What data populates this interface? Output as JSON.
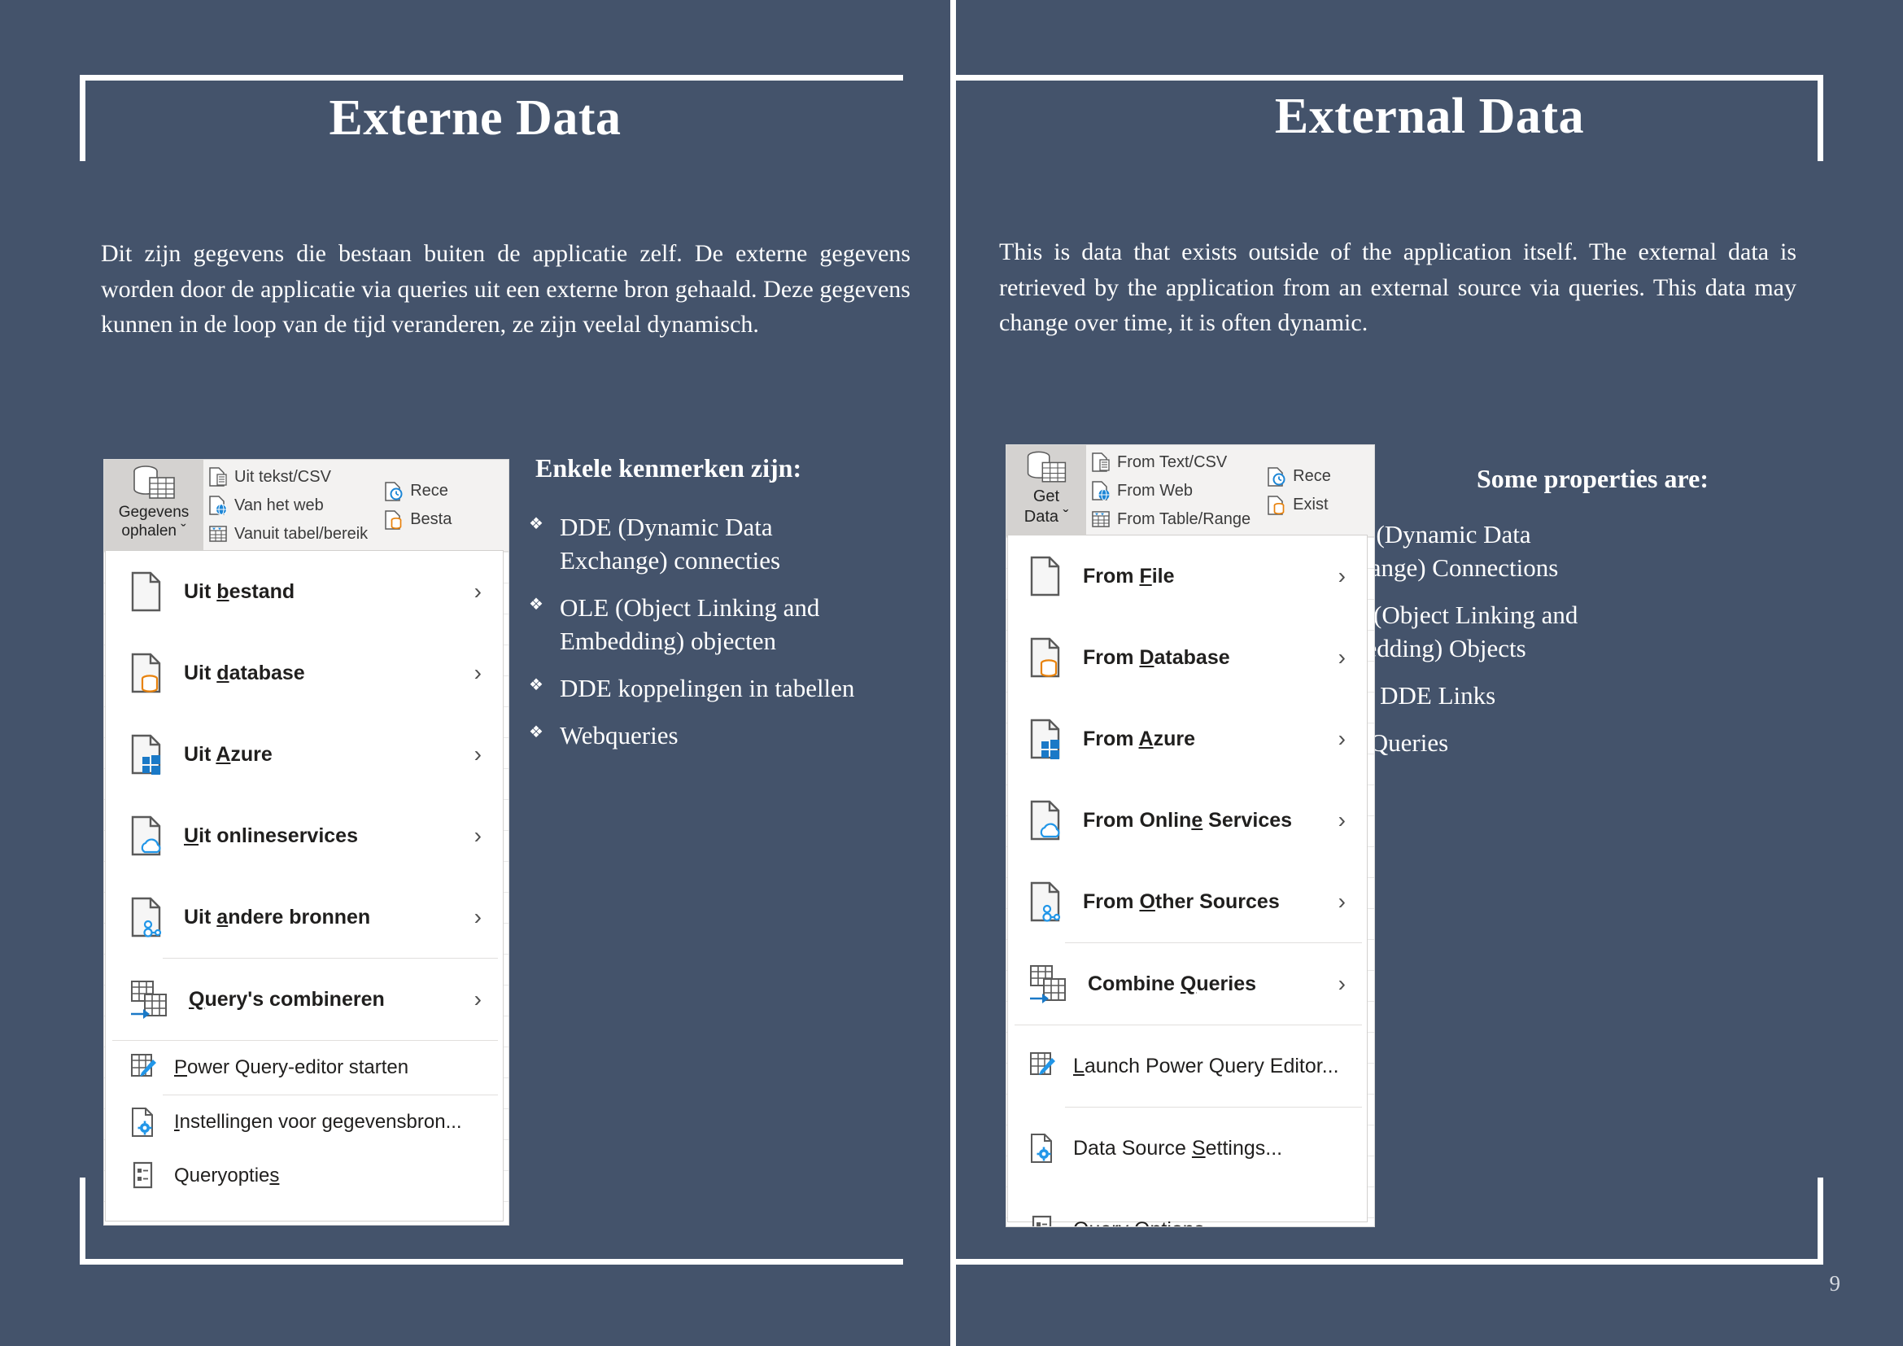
{
  "page": {
    "number": "9",
    "background_color": "#44536b",
    "accent_color": "#ffffff"
  },
  "left": {
    "title": "Externe Data",
    "paragraph": "Dit zijn gegevens die bestaan buiten de applicatie zelf. De externe gegevens worden door de applicatie via queries uit een externe bron gehaald. Deze gegevens kunnen in de loop van de tijd veranderen, ze zijn veelal dynamisch.",
    "properties_heading": "Enkele kenmerken zijn:",
    "properties": [
      "DDE (Dynamic Data Exchange) connecties",
      "OLE (Object Linking and Embedding) objecten",
      "DDE koppelingen in tabellen",
      "Webqueries"
    ],
    "bullet_glyph": "❖",
    "excel": {
      "ribbon_button": {
        "line1": "Gegevens",
        "line2": "ophalen ˇ",
        "icon": "get-data-icon"
      },
      "ribbon_items_col1": [
        {
          "label": "Uit tekst/CSV",
          "icon": "text-csv-icon"
        },
        {
          "label": "Van het web",
          "icon": "from-web-icon"
        },
        {
          "label": "Vanuit tabel/bereik",
          "icon": "from-table-icon"
        }
      ],
      "ribbon_items_col2": [
        {
          "label": "Rece",
          "icon": "recent-sources-icon"
        },
        {
          "label": "Besta",
          "icon": "existing-connections-icon"
        }
      ],
      "menu_items": [
        {
          "label": "Uit bestand",
          "accel": "b",
          "icon": "file-icon",
          "chevron": "›"
        },
        {
          "label": "Uit database",
          "accel": "d",
          "icon": "database-icon",
          "chevron": "›"
        },
        {
          "label": "Uit Azure",
          "accel": "A",
          "icon": "azure-icon",
          "chevron": "›"
        },
        {
          "label": "Uit onlineservices",
          "accel": "U",
          "icon": "cloud-icon",
          "chevron": "›"
        },
        {
          "label": "Uit andere bronnen",
          "accel": "a",
          "icon": "other-sources-icon",
          "chevron": "›"
        },
        {
          "label": "Query's combineren",
          "accel": "Q",
          "icon": "combine-queries-icon",
          "chevron": "›"
        }
      ],
      "menu_footer_items": [
        {
          "label": "Power Query-editor starten",
          "accel": "P",
          "icon": "power-query-editor-icon"
        },
        {
          "label": "Instellingen voor gegevensbron...",
          "accel": "I",
          "icon": "data-source-settings-icon"
        },
        {
          "label": "Queryopties",
          "accel": "s",
          "icon": "query-options-icon"
        }
      ]
    }
  },
  "right": {
    "title": "External Data",
    "paragraph": "This is data that exists outside of the application itself. The external data is retrieved by the application from an external source via queries. This data may change over time, it is often dynamic.",
    "properties_heading": "Some properties are:",
    "properties": [
      "DDE (Dynamic Data Exchange) Connections",
      "OLE (Object Linking and Embedding) Objects",
      "Table DDE Links",
      "Web Queries"
    ],
    "bullet_glyph": "❖",
    "excel": {
      "ribbon_button": {
        "line1": "Get",
        "line2": "Data ˇ",
        "icon": "get-data-icon"
      },
      "ribbon_items_col1": [
        {
          "label": "From Text/CSV",
          "icon": "text-csv-icon"
        },
        {
          "label": "From Web",
          "icon": "from-web-icon"
        },
        {
          "label": "From Table/Range",
          "icon": "from-table-icon"
        }
      ],
      "ribbon_items_col2": [
        {
          "label": "Rece",
          "icon": "recent-sources-icon"
        },
        {
          "label": "Exist",
          "icon": "existing-connections-icon"
        }
      ],
      "menu_items": [
        {
          "label": "From File",
          "accel": "F",
          "icon": "file-icon",
          "chevron": "›"
        },
        {
          "label": "From Database",
          "accel": "D",
          "icon": "database-icon",
          "chevron": "›"
        },
        {
          "label": "From Azure",
          "accel": "A",
          "icon": "azure-icon",
          "chevron": "›"
        },
        {
          "label": "From Online Services",
          "accel": "e",
          "icon": "cloud-icon",
          "chevron": "›"
        },
        {
          "label": "From Other Sources",
          "accel": "O",
          "icon": "other-sources-icon",
          "chevron": "›"
        },
        {
          "label": "Combine Queries",
          "accel": "Q",
          "icon": "combine-queries-icon",
          "chevron": "›"
        }
      ],
      "menu_footer_items": [
        {
          "label": "Launch Power Query Editor...",
          "accel": "L",
          "icon": "power-query-editor-icon"
        },
        {
          "label": "Data Source Settings...",
          "accel": "S",
          "icon": "data-source-settings-icon"
        },
        {
          "label": "Query Options",
          "accel": "p",
          "icon": "query-options-icon"
        }
      ]
    }
  }
}
